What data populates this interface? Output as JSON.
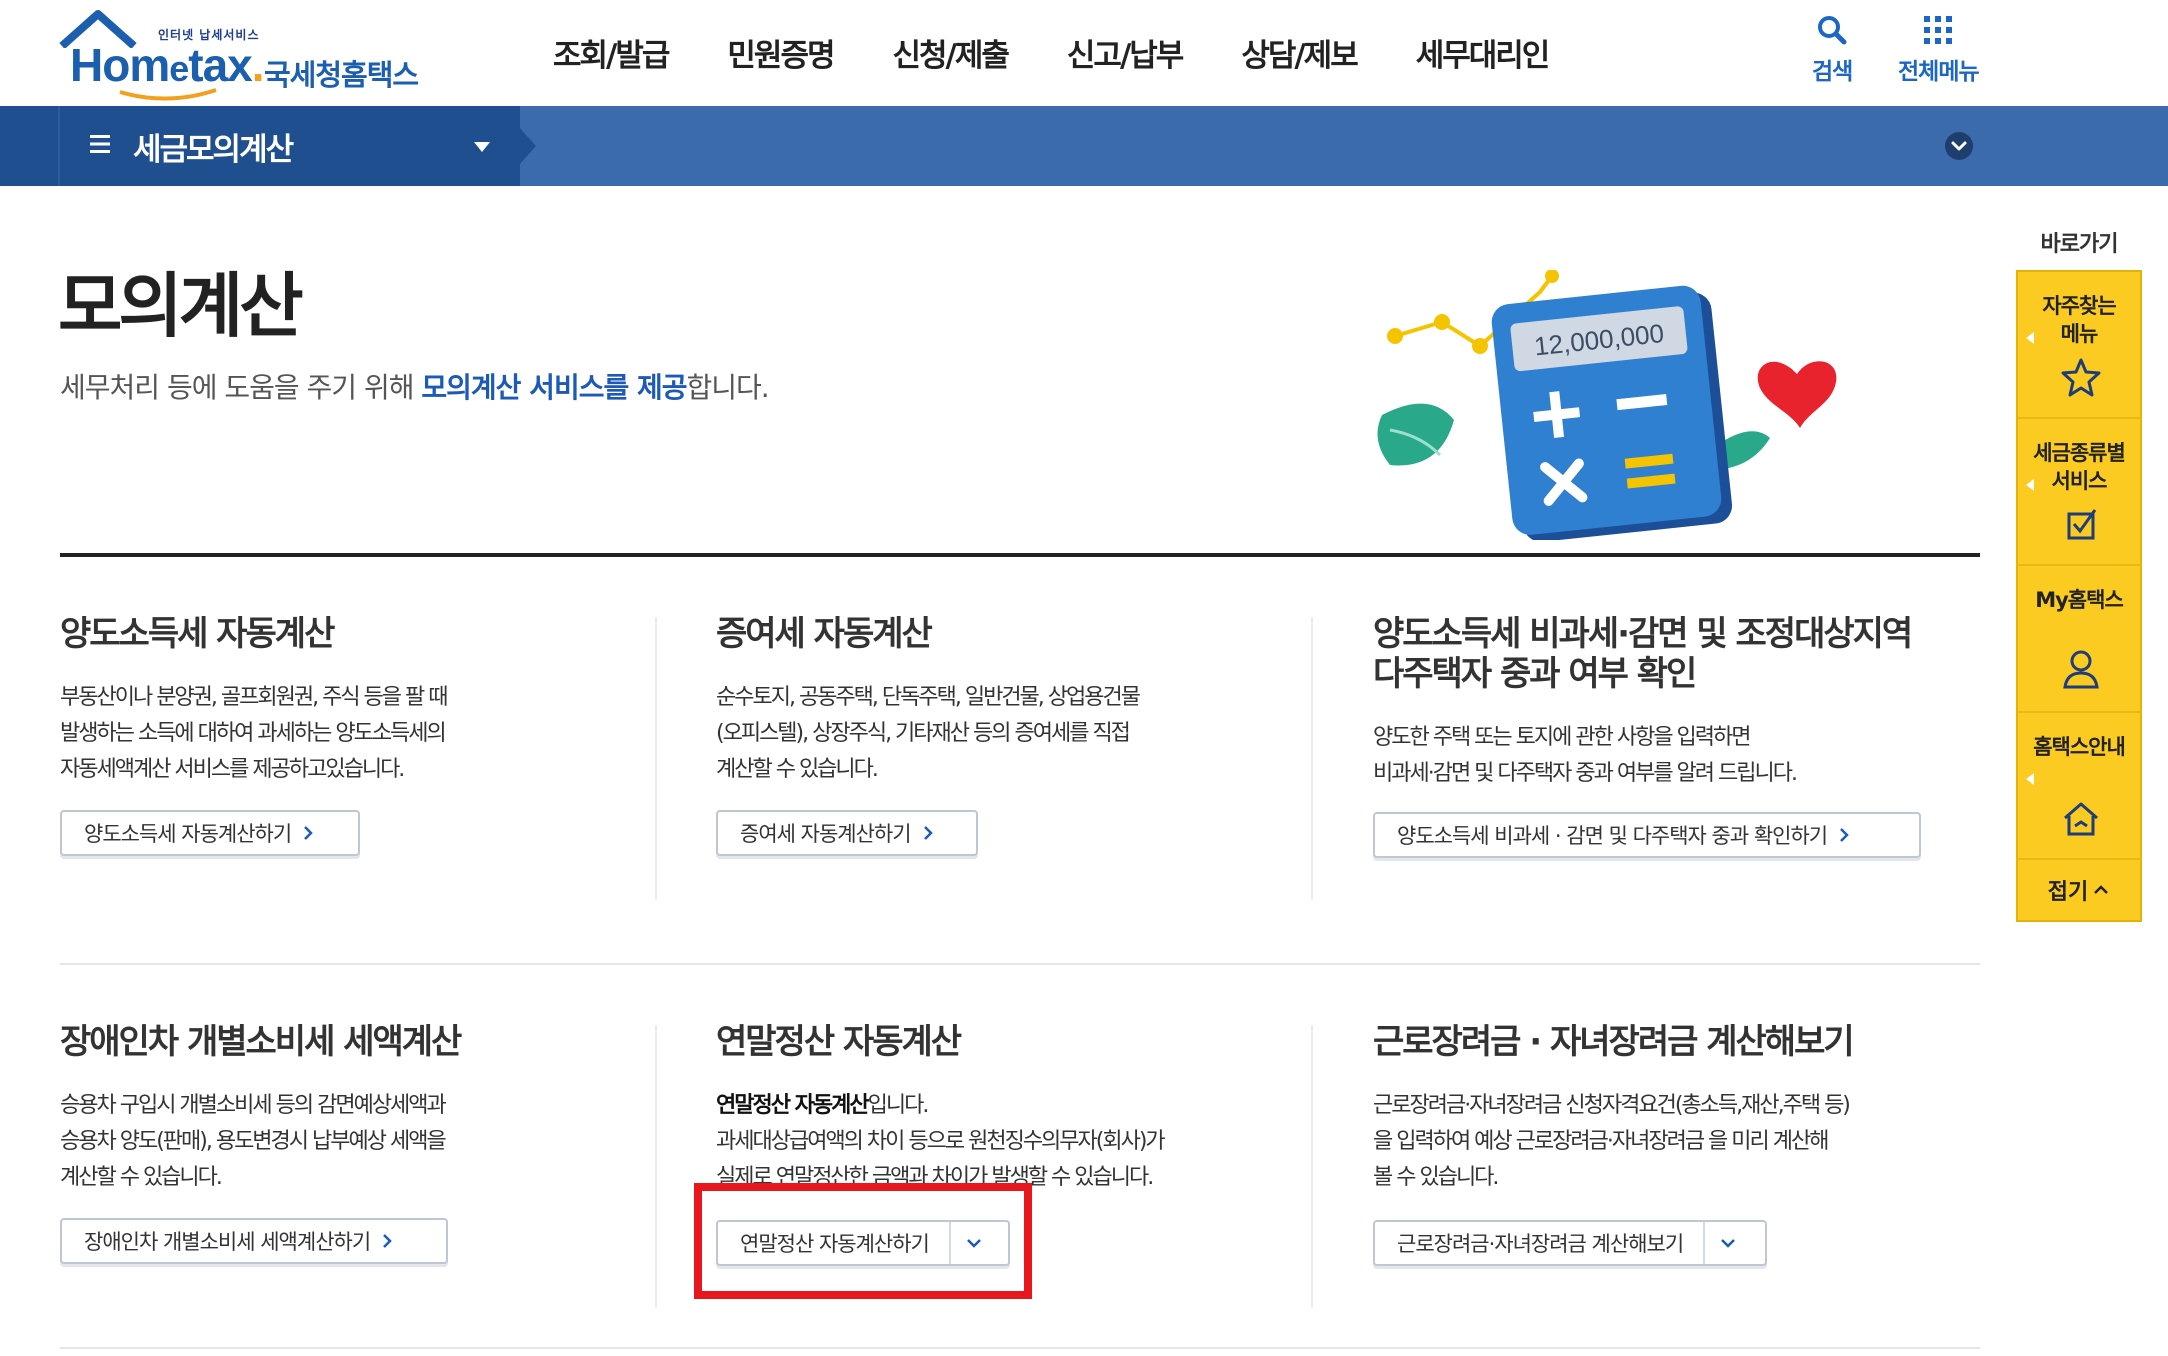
{
  "header": {
    "logo_small": "인터넷 납세서비스",
    "logo_brand_pre": "Hom",
    "logo_brand_e": "e",
    "logo_brand_post": "tax",
    "logo_brand_kr": "국세청홈택스",
    "nav": [
      "조회/발급",
      "민원증명",
      "신청/제출",
      "신고/납부",
      "상담/제보",
      "세무대리인"
    ],
    "search_label": "검색",
    "allmenu_label": "전체메뉴"
  },
  "subbar": {
    "title": "세금모의계산"
  },
  "hero": {
    "title": "모의계산",
    "desc_pre": "세무처리 등에 도움을 주기 위해 ",
    "desc_highlight": "모의계산 서비스를 제공",
    "desc_post": "합니다.",
    "calculator_display": "12,000,000"
  },
  "cards": [
    {
      "title": "양도소득세 자동계산",
      "desc": [
        "부동산이나 분양권, 골프회원권, 주식 등을 팔 때",
        "발생하는 소득에 대하여 과세하는 양도소득세의",
        "자동세액계산 서비스를 제공하고있습니다."
      ],
      "button": "양도소득세 자동계산하기"
    },
    {
      "title": "증여세 자동계산",
      "desc": [
        "순수토지, 공동주택, 단독주택, 일반건물, 상업용건물",
        "(오피스텔), 상장주식, 기타재산 등의 증여세를 직접",
        "계산할 수 있습니다."
      ],
      "button": "증여세 자동계산하기"
    },
    {
      "title_lines": [
        "양도소득세 비과세·감면 및 조정대상지역",
        "다주택자 중과 여부 확인"
      ],
      "desc": [
        "양도한 주택 또는 토지에 관한 사항을 입력하면",
        "비과세·감면 및 다주택자 중과 여부를 알려 드립니다."
      ],
      "button": "양도소득세 비과세 · 감면 및 다주택자 중과 확인하기"
    },
    {
      "title": "장애인차 개별소비세 세액계산",
      "desc": [
        "승용차 구입시 개별소비세 등의 감면예상세액과",
        "승용차 양도(판매), 용도변경시 납부예상 세액을",
        "계산할 수 있습니다."
      ],
      "button": "장애인차 개별소비세 세액계산하기"
    },
    {
      "title": "연말정산 자동계산",
      "desc_bold": "연말정산 자동계산",
      "desc_first_rest": "입니다.",
      "desc": [
        "과세대상급여액의 차이 등으로 원천징수의무자(회사)가",
        "실제로 연말정산한 금액과 차이가 발생할 수 있습니다."
      ],
      "button": "연말정산 자동계산하기"
    },
    {
      "title": "근로장려금 · 자녀장려금 계산해보기",
      "desc": [
        "근로장려금·자녀장려금 신청자격요건(총소득,재산,주택 등)",
        "을 입력하여 예상 근로장려금·자녀장려금 을 미리 계산해",
        "볼 수 있습니다."
      ],
      "button": "근로장려금·자녀장려금 계산해보기"
    }
  ],
  "quick": {
    "title": "바로가기",
    "items": [
      {
        "label_lines": [
          "자주찾는",
          "메뉴"
        ],
        "icon": "star-icon"
      },
      {
        "label_lines": [
          "세금종류별",
          "서비스"
        ],
        "icon": "check-box-icon"
      },
      {
        "label_lines": [
          "My홈택스"
        ],
        "icon": "user-icon"
      },
      {
        "label_lines": [
          "홈택스안내"
        ],
        "icon": "home-icon"
      }
    ],
    "fold_label": "접기"
  },
  "colors": {
    "primary_blue": "#1d5ab7",
    "bar_dark": "#1f4f8e",
    "bar_light": "#3b6bad",
    "quick_yellow": "#fbcb21",
    "highlight_red": "#e8171e"
  }
}
